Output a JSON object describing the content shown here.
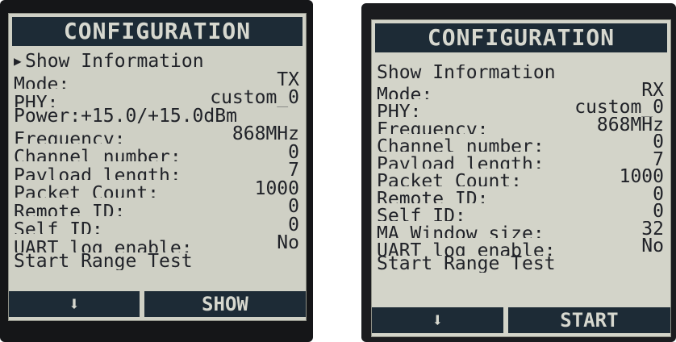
{
  "tx_screen": {
    "title": "CONFIGURATION",
    "selected_index": 0,
    "rows": [
      {
        "label": "Show Information",
        "value": ""
      },
      {
        "label": "Mode:",
        "value": "TX"
      },
      {
        "label": "PHY:",
        "value": "custom_0"
      },
      {
        "label": "Power:+15.0/+15.0dBm",
        "value": ""
      },
      {
        "label": "Frequency:",
        "value": "868MHz"
      },
      {
        "label": "Channel number:",
        "value": "0"
      },
      {
        "label": "Payload length:",
        "value": "7"
      },
      {
        "label": "Packet Count:",
        "value": "1000"
      },
      {
        "label": "Remote ID:",
        "value": "0"
      },
      {
        "label": "Self ID:",
        "value": "0"
      },
      {
        "label": "UART log enable:",
        "value": "No"
      },
      {
        "label": "Start Range Test",
        "value": ""
      }
    ],
    "softkey_left": "⬇",
    "softkey_right": "SHOW"
  },
  "rx_screen": {
    "title": "CONFIGURATION",
    "selected_index": 12,
    "rows": [
      {
        "label": "Show Information",
        "value": ""
      },
      {
        "label": "Mode:",
        "value": "RX"
      },
      {
        "label": "PHY:",
        "value": "custom_0"
      },
      {
        "label": "Frequency:",
        "value": "868MHz"
      },
      {
        "label": "Channel number:",
        "value": "0"
      },
      {
        "label": "Payload length:",
        "value": "7"
      },
      {
        "label": "Packet Count:",
        "value": "1000"
      },
      {
        "label": "Remote ID:",
        "value": "0"
      },
      {
        "label": "Self ID:",
        "value": "0"
      },
      {
        "label": "MA Window size:",
        "value": "32"
      },
      {
        "label": "UART log enable:",
        "value": "No"
      },
      {
        "label": "Start Range Test",
        "value": ""
      }
    ],
    "softkey_left": "⬇",
    "softkey_right": "START"
  },
  "cursor_glyph": "▶",
  "colors": {
    "lcd_background": "#cfd0c5",
    "lcd_text": "#202228",
    "bar_background": "#1d2b36",
    "bar_text": "#d7d8cf",
    "bezel": "#151618"
  }
}
